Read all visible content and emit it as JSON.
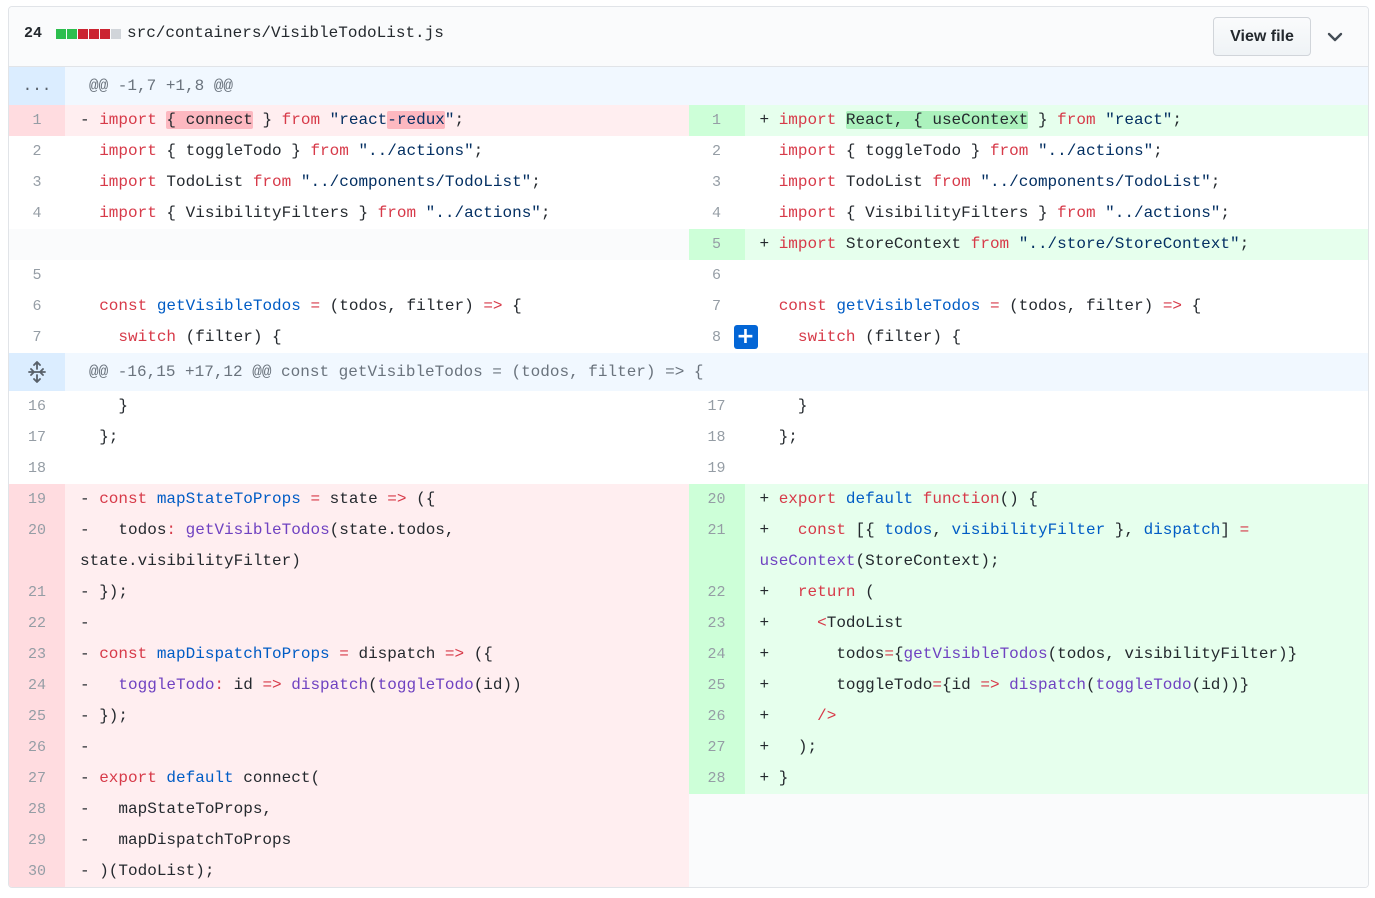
{
  "header": {
    "change_count": "24",
    "file_path": "src/containers/VisibleTodoList.js",
    "view_file_label": "View file",
    "diffstat_colors": [
      "#2cbe4e",
      "#2cbe4e",
      "#cb2431",
      "#cb2431",
      "#cb2431",
      "#d1d5da"
    ]
  },
  "hunks": [
    {
      "expander": "...",
      "text": "@@ -1,7 +1,8 @@"
    },
    {
      "expander": "expand-icon",
      "text": "@@ -16,15 +17,12 @@ const getVisibleTodos = (todos, filter) => {"
    }
  ],
  "left_lines": [
    {
      "num": "1",
      "text": "- import { connect } from \"react-redux\";"
    },
    {
      "num": "2",
      "text": "  import { toggleTodo } from \"../actions\";"
    },
    {
      "num": "3",
      "text": "  import TodoList from \"../components/TodoList\";"
    },
    {
      "num": "4",
      "text": "  import { VisibilityFilters } from \"../actions\";"
    },
    {
      "num": "5",
      "text": ""
    },
    {
      "num": "6",
      "text": "  const getVisibleTodos = (todos, filter) => {"
    },
    {
      "num": "7",
      "text": "    switch (filter) {"
    },
    {
      "num": "16",
      "text": "    }"
    },
    {
      "num": "17",
      "text": "  };"
    },
    {
      "num": "18",
      "text": ""
    },
    {
      "num": "19",
      "text": "- const mapStateToProps = state => ({"
    },
    {
      "num": "20",
      "text": "-   todos: getVisibleTodos(state.todos, state.visibilityFilter)"
    },
    {
      "num": "21",
      "text": "- });"
    },
    {
      "num": "22",
      "text": "-"
    },
    {
      "num": "23",
      "text": "- const mapDispatchToProps = dispatch => ({"
    },
    {
      "num": "24",
      "text": "-   toggleTodo: id => dispatch(toggleTodo(id))"
    },
    {
      "num": "25",
      "text": "- });"
    },
    {
      "num": "26",
      "text": "-"
    },
    {
      "num": "27",
      "text": "- export default connect("
    },
    {
      "num": "28",
      "text": "-   mapStateToProps,"
    },
    {
      "num": "29",
      "text": "-   mapDispatchToProps"
    },
    {
      "num": "30",
      "text": "- )(TodoList);"
    }
  ],
  "right_lines": [
    {
      "num": "1",
      "text": "+ import React, { useContext } from \"react\";"
    },
    {
      "num": "2",
      "text": "  import { toggleTodo } from \"../actions\";"
    },
    {
      "num": "3",
      "text": "  import TodoList from \"../components/TodoList\";"
    },
    {
      "num": "4",
      "text": "  import { VisibilityFilters } from \"../actions\";"
    },
    {
      "num": "5",
      "text": "+ import StoreContext from \"../store/StoreContext\";"
    },
    {
      "num": "6",
      "text": ""
    },
    {
      "num": "7",
      "text": "  const getVisibleTodos = (todos, filter) => {"
    },
    {
      "num": "8",
      "text": "    switch (filter) {"
    },
    {
      "num": "17",
      "text": "    }"
    },
    {
      "num": "18",
      "text": "  };"
    },
    {
      "num": "19",
      "text": ""
    },
    {
      "num": "20",
      "text": "+ export default function() {"
    },
    {
      "num": "21",
      "text": "+   const [{ todos, visibilityFilter }, dispatch] = useContext(StoreContext);"
    },
    {
      "num": "22",
      "text": "+   return ("
    },
    {
      "num": "23",
      "text": "+     <TodoList"
    },
    {
      "num": "24",
      "text": "+       todos={getVisibleTodos(todos, visibilityFilter)}"
    },
    {
      "num": "25",
      "text": "+       toggleTodo={id => dispatch(toggleTodo(id))}"
    },
    {
      "num": "26",
      "text": "+     />"
    },
    {
      "num": "27",
      "text": "+   );"
    },
    {
      "num": "28",
      "text": "+ }"
    }
  ]
}
